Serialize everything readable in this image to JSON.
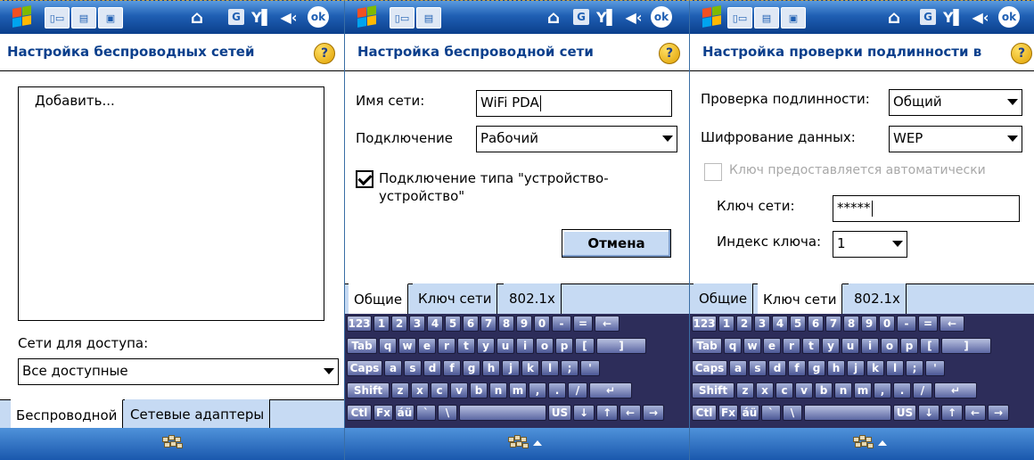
{
  "status_icons": [
    "windows-start-icon",
    "connectivity-icon",
    "home-icon",
    "gprs-icon",
    "signal-icon",
    "volume-icon",
    "ok-icon"
  ],
  "ok_label": "ok",
  "g_label": "G",
  "screen1": {
    "title": "Настройка беспроводных сетей",
    "list_items": [
      "Добавить..."
    ],
    "access_label": "Сети для доступа:",
    "access_value": "Все доступные",
    "tabs": [
      "Беспроводной",
      "Сетевые адаптеры"
    ]
  },
  "screen2": {
    "title": "Настройка беспроводной сети",
    "ssid_label": "Имя сети:",
    "ssid_value": "WiFi PDA",
    "connect_label": "Подключение",
    "connect_value": "Рабочий",
    "adhoc_label": "Подключение типа \"устройство-устройство\"",
    "adhoc_checked": true,
    "cancel_label": "Отмена",
    "tabs": [
      "Общие",
      "Ключ сети",
      "802.1x"
    ]
  },
  "screen3": {
    "title": "Настройка проверки подлинности в",
    "auth_label": "Проверка подлинности:",
    "auth_value": "Общий",
    "encrypt_label": "Шифрование данных:",
    "encrypt_value": "WEP",
    "auto_key_label": "Ключ предоставляется автоматически",
    "auto_key_checked": false,
    "key_label": "Ключ сети:",
    "key_value": "*****",
    "index_label": "Индекс ключа:",
    "index_value": "1",
    "tabs": [
      "Общие",
      "Ключ сети",
      "802.1x"
    ]
  },
  "keyboard": {
    "row1": [
      "123",
      "1",
      "2",
      "3",
      "4",
      "5",
      "6",
      "7",
      "8",
      "9",
      "0",
      "-",
      "=",
      "←"
    ],
    "row2": [
      "Tab",
      "q",
      "w",
      "e",
      "r",
      "t",
      "y",
      "u",
      "i",
      "o",
      "p",
      "[",
      "]"
    ],
    "row3": [
      "Caps",
      "a",
      "s",
      "d",
      "f",
      "g",
      "h",
      "j",
      "k",
      "l",
      ";",
      "'"
    ],
    "row4": [
      "Shift",
      "z",
      "x",
      "c",
      "v",
      "b",
      "n",
      "m",
      ",",
      ".",
      "/",
      "↵"
    ],
    "row5": [
      "Ctl",
      "Fx",
      "áü",
      "`",
      "\\",
      "",
      "US",
      "↓",
      "↑",
      "←",
      "→"
    ]
  }
}
